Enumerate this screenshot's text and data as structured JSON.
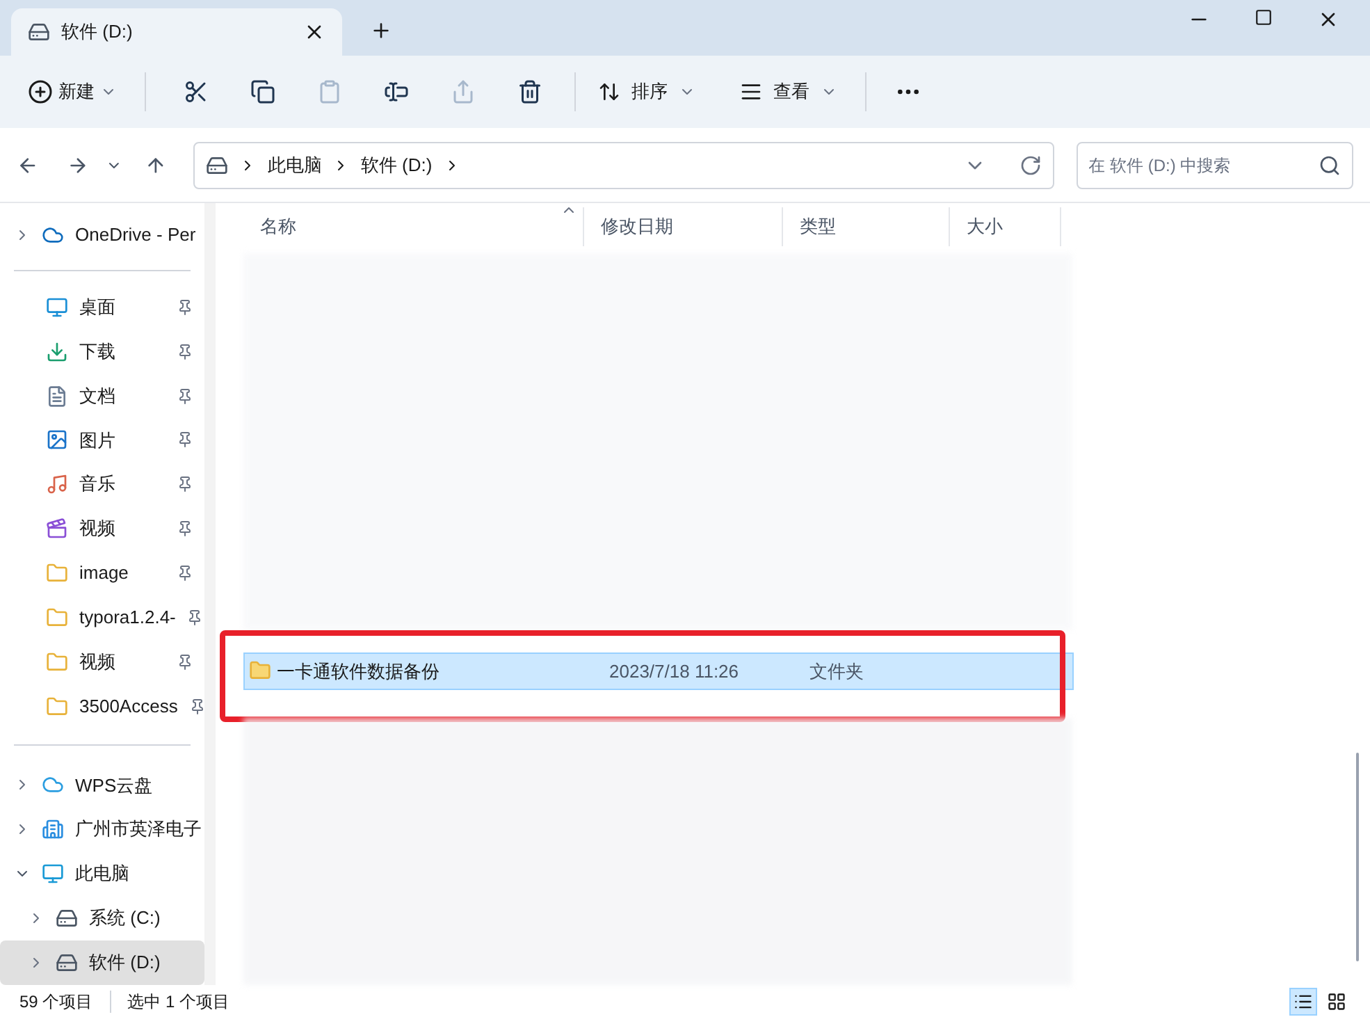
{
  "window": {
    "tabs": [
      {
        "title": "软件 (D:)",
        "selected": true
      }
    ]
  },
  "toolbar": {
    "new_label": "新建",
    "actions": [
      {
        "kind": "cut",
        "disabled": false
      },
      {
        "kind": "copy",
        "disabled": false
      },
      {
        "kind": "paste",
        "disabled": true
      },
      {
        "kind": "rename",
        "disabled": false
      },
      {
        "kind": "share",
        "disabled": true
      },
      {
        "kind": "delete",
        "disabled": false
      }
    ],
    "sort_label": "排序",
    "view_label": "查看"
  },
  "address": {
    "crumbs": [
      "此电脑",
      "软件 (D:)"
    ],
    "search_placeholder": "在 软件 (D:) 中搜索"
  },
  "sidebar": {
    "top": [
      {
        "label": "OneDrive - Per",
        "kind": "onedrive",
        "expanded": false
      }
    ],
    "quick_access": [
      {
        "label": "桌面",
        "kind": "desktop",
        "pinned": true
      },
      {
        "label": "下载",
        "kind": "downloads",
        "pinned": true
      },
      {
        "label": "文档",
        "kind": "documents",
        "pinned": true
      },
      {
        "label": "图片",
        "kind": "pictures",
        "pinned": true
      },
      {
        "label": "音乐",
        "kind": "music",
        "pinned": true
      },
      {
        "label": "视频",
        "kind": "videos",
        "pinned": true
      },
      {
        "label": "image",
        "kind": "folder",
        "pinned": true
      },
      {
        "label": "typora1.2.4-",
        "kind": "folder",
        "pinned": true
      },
      {
        "label": "视频",
        "kind": "folder",
        "pinned": true
      },
      {
        "label": "3500Access",
        "kind": "folder",
        "pinned": true
      }
    ],
    "tree": [
      {
        "label": "WPS云盘",
        "kind": "cloud",
        "expanded": false,
        "selected": false
      },
      {
        "label": "广州市英泽电子",
        "kind": "org",
        "expanded": false,
        "selected": false
      },
      {
        "label": "此电脑",
        "kind": "pc",
        "expanded": true,
        "selected": false,
        "children": [
          {
            "label": "系统 (C:)",
            "kind": "drive",
            "expanded": false,
            "selected": false
          },
          {
            "label": "软件 (D:)",
            "kind": "drive",
            "expanded": false,
            "selected": true
          }
        ]
      }
    ]
  },
  "file_list": {
    "columns": [
      {
        "label": "名称",
        "sorted": true
      },
      {
        "label": "修改日期",
        "sorted": false
      },
      {
        "label": "类型",
        "sorted": false
      },
      {
        "label": "大小",
        "sorted": false
      }
    ],
    "rows": [
      {
        "name": "一卡通软件数据备份",
        "modified": "2023/7/18 11:26",
        "type": "文件夹",
        "selected": true,
        "highlighted": true
      }
    ]
  },
  "status_bar": {
    "count": "59 个项目",
    "selection": "选中 1 个项目",
    "view_buttons": [
      {
        "kind": "details",
        "selected": true
      },
      {
        "kind": "tiles",
        "selected": false
      }
    ]
  }
}
